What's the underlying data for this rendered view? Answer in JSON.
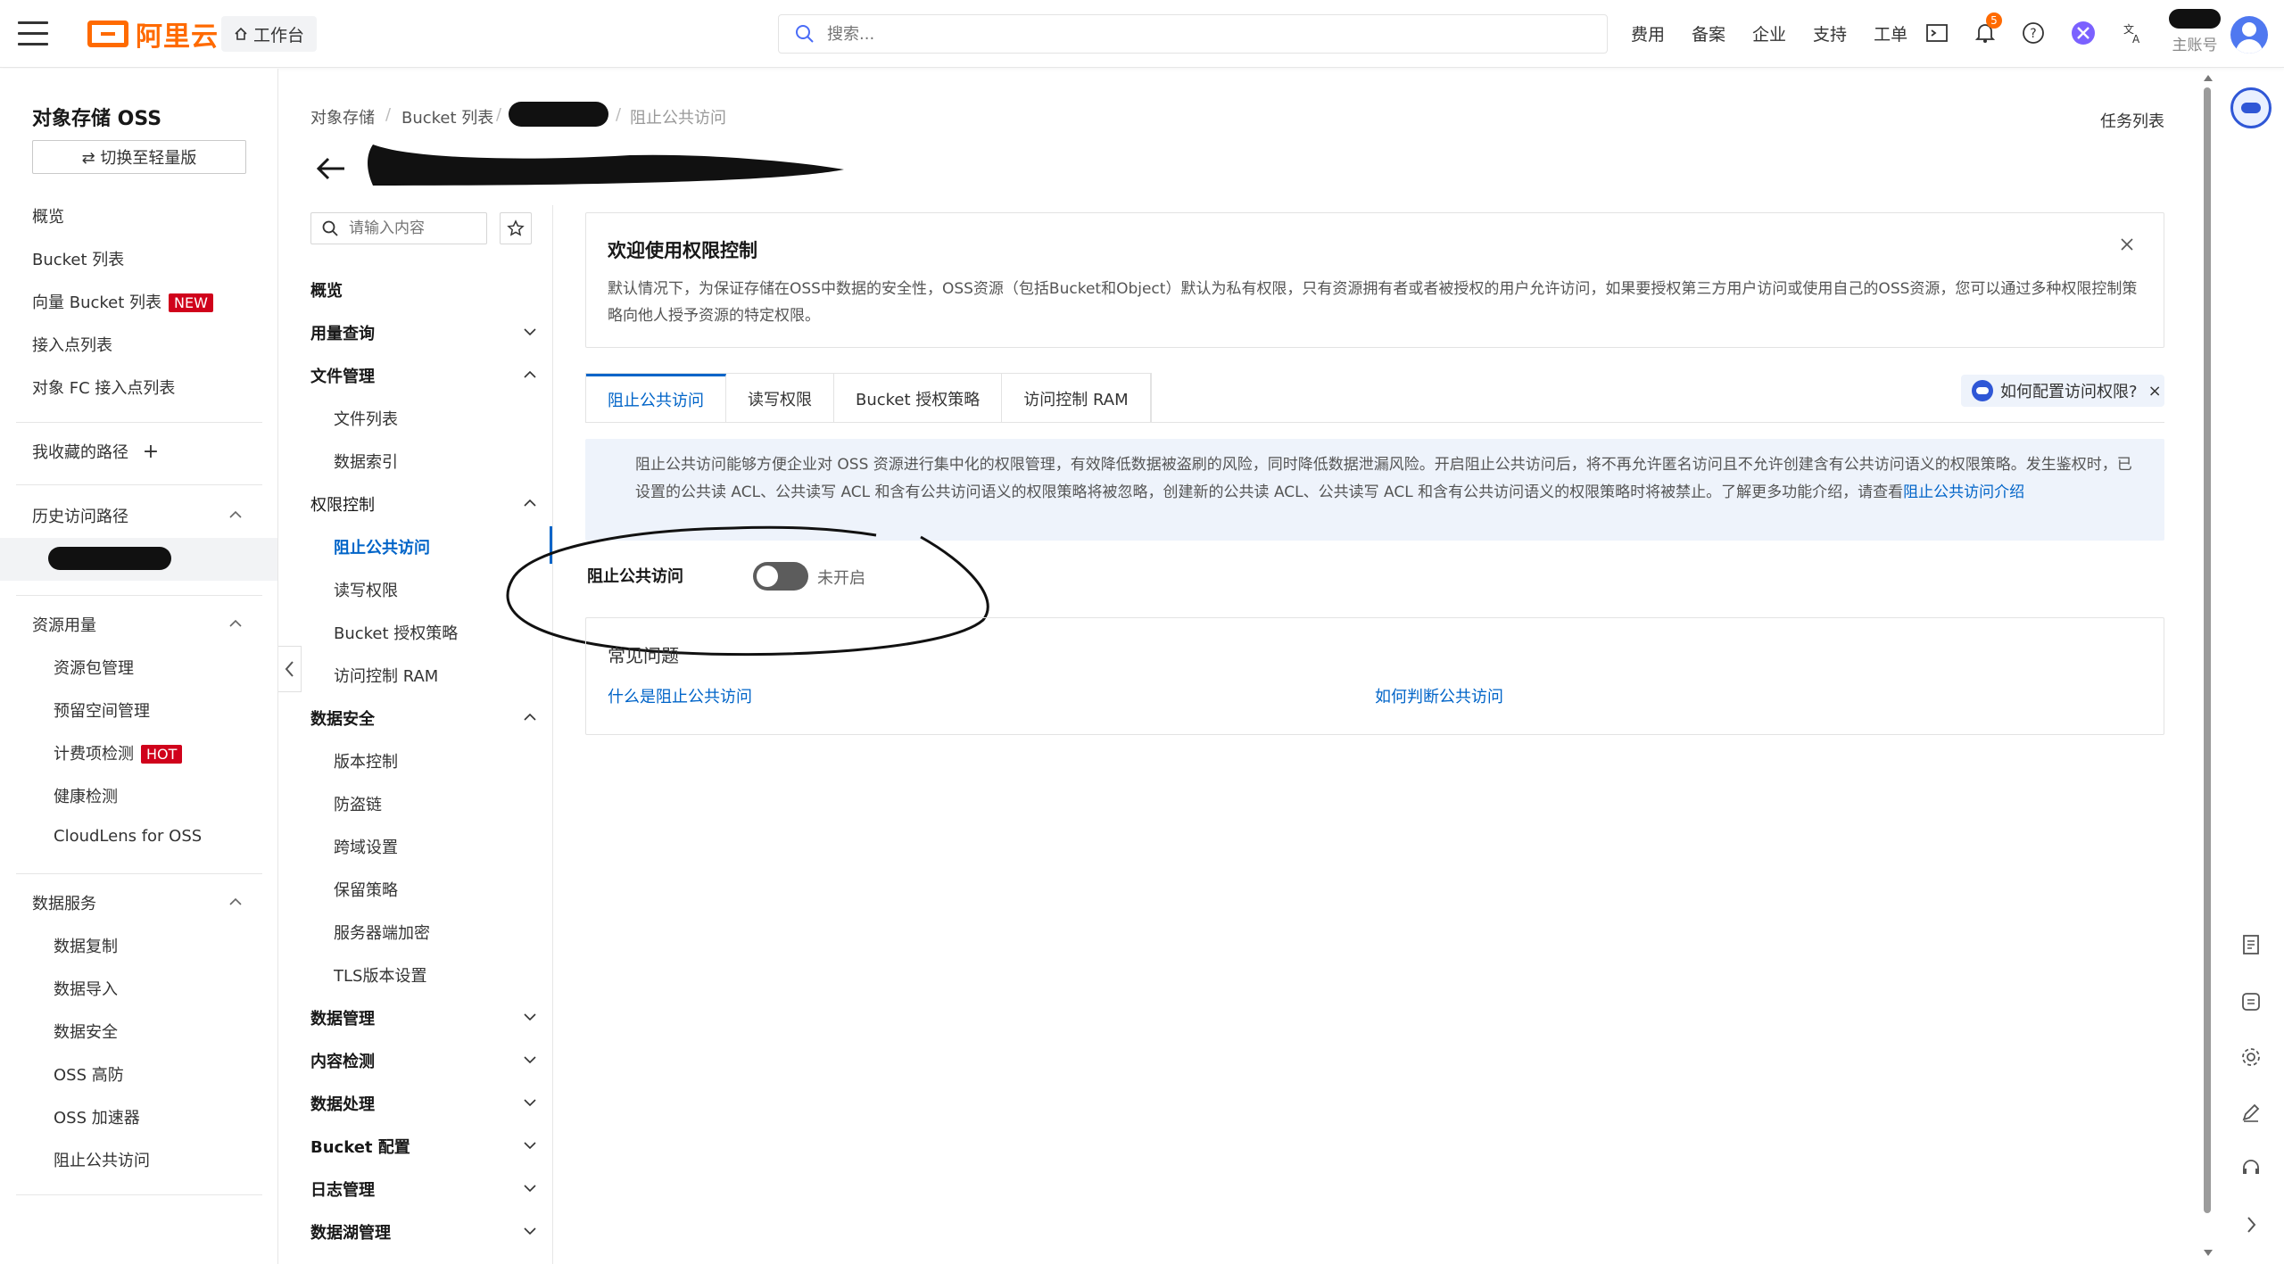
{
  "topbar": {
    "logo": "阿里云",
    "workbench": "工作台",
    "search_placeholder": "搜索...",
    "links": [
      "费用",
      "备案",
      "企业",
      "支持",
      "工单"
    ],
    "notification_count": "5",
    "account_label": "主账号"
  },
  "sidebar": {
    "title": "对象存储 OSS",
    "switch_label": "⇄ 切换至轻量版",
    "items": {
      "overview": "概览",
      "bucket_list": "Bucket 列表",
      "vector_bucket_list": "向量 Bucket 列表",
      "vector_tag": "NEW",
      "access_points": "接入点列表",
      "fc_access_points": "对象 FC 接入点列表",
      "favorites": "我收藏的路径",
      "history": "历史访问路径",
      "resource_usage": "资源用量",
      "resource_pack": "资源包管理",
      "reserved_space": "预留空间管理",
      "billing_check": "计费项检测",
      "billing_tag": "HOT",
      "health_check": "健康检测",
      "cloudlens": "CloudLens for OSS",
      "data_services": "数据服务",
      "data_replication": "数据复制",
      "data_import": "数据导入",
      "data_security": "数据安全",
      "oss_hifi": "OSS 高防",
      "oss_accelerator": "OSS 加速器",
      "block_public_access": "阻止公共访问"
    }
  },
  "breadcrumb": [
    "对象存储",
    "Bucket 列表",
    "阻止公共访问"
  ],
  "task_list": "任务列表",
  "subnav": {
    "search_placeholder": "请输入内容",
    "overview": "概览",
    "usage_query": "用量查询",
    "file_mgmt": "文件管理",
    "file_list": "文件列表",
    "data_index": "数据索引",
    "permission_ctrl": "权限控制",
    "block_public": "阻止公共访问",
    "rw_permission": "读写权限",
    "bucket_policy": "Bucket 授权策略",
    "ram_access": "访问控制 RAM",
    "data_security": "数据安全",
    "versioning": "版本控制",
    "hotlink": "防盗链",
    "cors": "跨域设置",
    "retention": "保留策略",
    "sse": "服务器端加密",
    "tls": "TLS版本设置",
    "data_mgmt": "数据管理",
    "content_detect": "内容检测",
    "data_processing": "数据处理",
    "bucket_config": "Bucket 配置",
    "log_mgmt": "日志管理",
    "datalake_mgmt": "数据湖管理"
  },
  "welcome": {
    "title": "欢迎使用权限控制",
    "text": "默认情况下，为保证存储在OSS中数据的安全性，OSS资源（包括Bucket和Object）默认为私有权限，只有资源拥有者或者被授权的用户允许访问，如果要授权第三方用户访问或使用自己的OSS资源，您可以通过多种权限控制策略向他人授予资源的特定权限。"
  },
  "tabs": [
    "阻止公共访问",
    "读写权限",
    "Bucket 授权策略",
    "访问控制 RAM"
  ],
  "help_pill": "如何配置访问权限?",
  "info": {
    "text": "阻止公共访问能够方便企业对 OSS 资源进行集中化的权限管理，有效降低数据被盗刷的风险，同时降低数据泄漏风险。开启阻止公共访问后，将不再允许匿名访问且不允许创建含有公共访问语义的权限策略。发生鉴权时，已设置的公共读 ACL、公共读写 ACL 和含有公共访问语义的权限策略将被忽略，创建新的公共读 ACL、公共读写 ACL 和含有公共访问语义的权限策略时将被禁止。了解更多功能介绍，请查看",
    "link": "阻止公共访问介绍"
  },
  "block_public_access": {
    "label": "阻止公共访问",
    "status": "未开启",
    "enabled": false
  },
  "faq": {
    "title": "常见问题",
    "links": [
      "什么是阻止公共访问",
      "如何判断公共访问"
    ]
  },
  "colors": {
    "brand": "#ff6a00",
    "primary": "#0064c8",
    "tag_red": "#d0021b",
    "info_bg": "#eef3fb"
  }
}
